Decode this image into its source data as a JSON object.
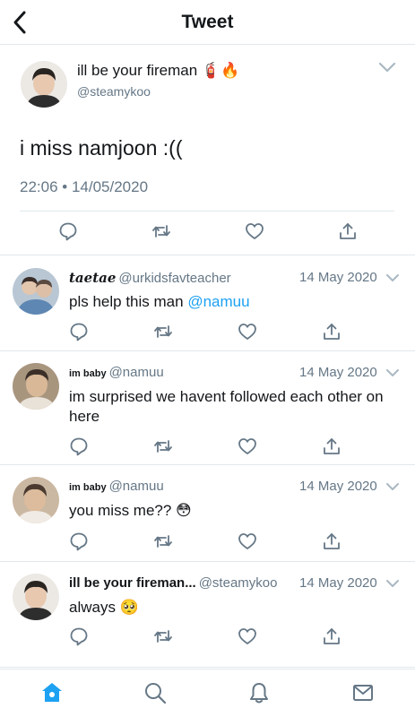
{
  "header": {
    "title": "Tweet"
  },
  "main_tweet": {
    "name": "ill be your fireman",
    "name_emojis": "🧯🔥",
    "handle": "@steamykoo",
    "text": "i miss namjoon :((",
    "timestamp": "22:06 • 14/05/2020"
  },
  "replies": [
    {
      "name": "taetae",
      "handle": "@urkidsfavteacher",
      "date": "14 May 2020",
      "text": "pls help this man",
      "mention": "@namuu",
      "avatar_colors": [
        "#8fa9c4",
        "#d9c2b3"
      ]
    },
    {
      "name": "im baby",
      "handle": "@namuu",
      "date": "14 May 2020",
      "text": "im surprised we havent followed each other on here",
      "mention": "",
      "avatar_colors": [
        "#b8a48c",
        "#e3d4c4"
      ]
    },
    {
      "name": "im baby",
      "handle": "@namuu",
      "date": "14 May 2020",
      "text": "you miss me?? 😳",
      "mention": "",
      "avatar_colors": [
        "#c9b49b",
        "#e8dcd0"
      ]
    },
    {
      "name": "ill be your fireman...",
      "handle": "@steamykoo",
      "date": "14 May 2020",
      "text": "always 🥺",
      "mention": "",
      "avatar_colors": [
        "#e9e6e2",
        "#2b2b2b"
      ]
    }
  ],
  "icons": {
    "back": "chevron-left-icon",
    "reply": "reply-icon",
    "retweet": "retweet-icon",
    "like": "heart-icon",
    "share": "share-icon",
    "tabs": [
      "home-icon",
      "search-icon",
      "notifications-icon",
      "messages-icon"
    ]
  },
  "colors": {
    "accent": "#1da1f2",
    "icon_gray": "#657786",
    "divider": "#e1e8ed"
  }
}
